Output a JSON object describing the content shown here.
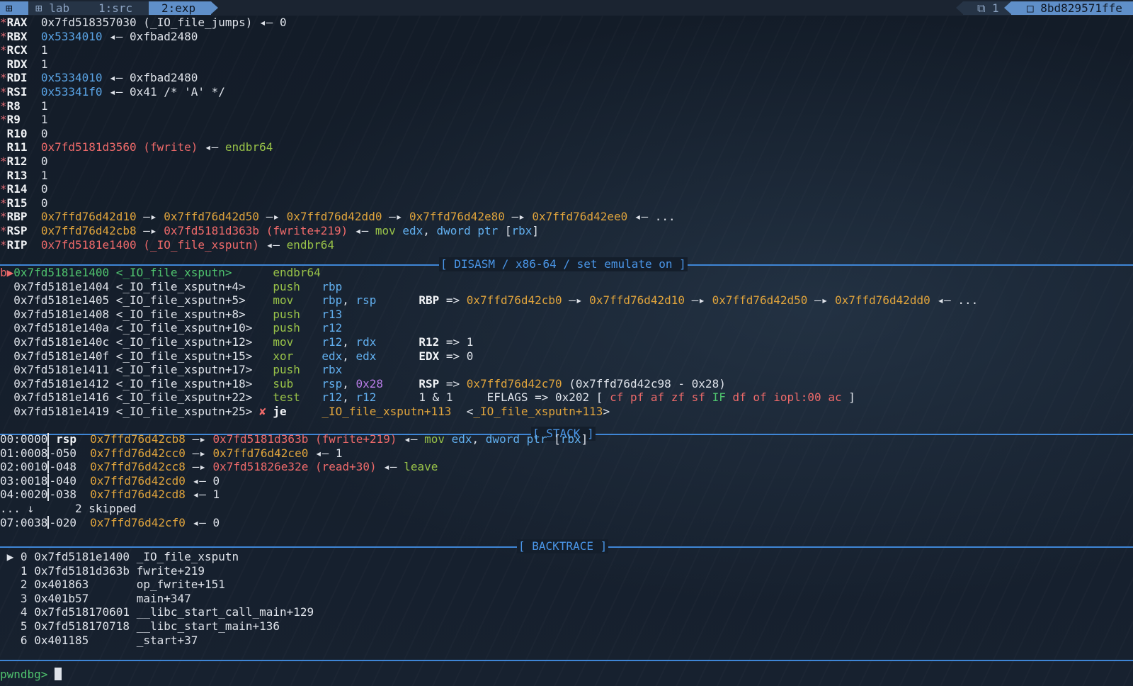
{
  "tmux": {
    "icon": "⊞",
    "session": "⊞ lab",
    "win1": "1:src",
    "win2": "2:exp",
    "right_count": "⧉ 1",
    "right_host": "□ 8bd829571ffe"
  },
  "registers": [
    {
      "star": "*",
      "name": "RAX",
      "parts": [
        [
          "w",
          "0x7fd518357030 (_IO_file_jumps) ◂— 0"
        ]
      ]
    },
    {
      "star": "*",
      "name": "RBX",
      "parts": [
        [
          "b",
          "0x5334010"
        ],
        [
          "w",
          " ◂— 0xfbad2480"
        ]
      ]
    },
    {
      "star": "*",
      "name": "RCX",
      "parts": [
        [
          "w",
          "1"
        ]
      ]
    },
    {
      "star": " ",
      "name": "RDX",
      "parts": [
        [
          "w",
          "1"
        ]
      ]
    },
    {
      "star": "*",
      "name": "RDI",
      "parts": [
        [
          "b",
          "0x5334010"
        ],
        [
          "w",
          " ◂— 0xfbad2480"
        ]
      ]
    },
    {
      "star": "*",
      "name": "RSI",
      "parts": [
        [
          "b",
          "0x53341f0"
        ],
        [
          "w",
          " ◂— 0x41 /* 'A' */"
        ]
      ]
    },
    {
      "star": "*",
      "name": "R8 ",
      "parts": [
        [
          "w",
          "1"
        ]
      ]
    },
    {
      "star": "*",
      "name": "R9 ",
      "parts": [
        [
          "w",
          "1"
        ]
      ]
    },
    {
      "star": " ",
      "name": "R10",
      "parts": [
        [
          "w",
          "0"
        ]
      ]
    },
    {
      "star": " ",
      "name": "R11",
      "parts": [
        [
          "r",
          "0x7fd5181d3560 (fwrite)"
        ],
        [
          "w",
          " ◂— "
        ],
        [
          "g",
          "endbr64"
        ]
      ]
    },
    {
      "star": "*",
      "name": "R12",
      "parts": [
        [
          "w",
          "0"
        ]
      ]
    },
    {
      "star": " ",
      "name": "R13",
      "parts": [
        [
          "w",
          "1"
        ]
      ]
    },
    {
      "star": "*",
      "name": "R14",
      "parts": [
        [
          "w",
          "0"
        ]
      ]
    },
    {
      "star": "*",
      "name": "R15",
      "parts": [
        [
          "w",
          "0"
        ]
      ]
    },
    {
      "star": "*",
      "name": "RBP",
      "parts": [
        [
          "o",
          "0x7ffd76d42d10"
        ],
        [
          "w",
          " —▸ "
        ],
        [
          "o",
          "0x7ffd76d42d50"
        ],
        [
          "w",
          " —▸ "
        ],
        [
          "o",
          "0x7ffd76d42dd0"
        ],
        [
          "w",
          " —▸ "
        ],
        [
          "o",
          "0x7ffd76d42e80"
        ],
        [
          "w",
          " —▸ "
        ],
        [
          "o",
          "0x7ffd76d42ee0"
        ],
        [
          "w",
          " ◂— ..."
        ]
      ]
    },
    {
      "star": "*",
      "name": "RSP",
      "parts": [
        [
          "o",
          "0x7ffd76d42cb8"
        ],
        [
          "w",
          " —▸ "
        ],
        [
          "r",
          "0x7fd5181d363b (fwrite+219)"
        ],
        [
          "w",
          " ◂— "
        ],
        [
          "g",
          "mov "
        ],
        [
          "c",
          "edx"
        ],
        [
          "w",
          ", "
        ],
        [
          "c",
          "dword ptr "
        ],
        [
          "w",
          "["
        ],
        [
          "c",
          "rbx"
        ],
        [
          "w",
          "]"
        ]
      ]
    },
    {
      "star": "*",
      "name": "RIP",
      "parts": [
        [
          "r",
          "0x7fd5181e1400 (_IO_file_xsputn)"
        ],
        [
          "w",
          " ◂— "
        ],
        [
          "g",
          "endbr64"
        ]
      ]
    }
  ],
  "sections": {
    "disasm": "[ DISASM / x86-64 / set emulate on ]",
    "stack": "[ STACK ]",
    "backtrace": "[ BACKTRACE ]"
  },
  "disasm": [
    {
      "marker": "b▶",
      "addr": "0x7fd5181e1400",
      "sym": "<_IO_file_xsputn>   ",
      "taken": " ",
      "mn": "endbr64",
      "ops": [],
      "emu": [],
      "current": true
    },
    {
      "marker": "  ",
      "addr": "0x7fd5181e1404",
      "sym": "<_IO_file_xsputn+4> ",
      "taken": " ",
      "mn": "push",
      "ops": [
        [
          "c",
          "rbp"
        ]
      ],
      "emu": []
    },
    {
      "marker": "  ",
      "addr": "0x7fd5181e1405",
      "sym": "<_IO_file_xsputn+5> ",
      "taken": " ",
      "mn": "mov",
      "ops": [
        [
          "c",
          "rbp"
        ],
        [
          "w",
          ", "
        ],
        [
          "c",
          "rsp"
        ]
      ],
      "emu": [
        [
          "bold",
          "RBP"
        ],
        [
          "w",
          " => "
        ],
        [
          "o",
          "0x7ffd76d42cb0"
        ],
        [
          "w",
          " —▸ "
        ],
        [
          "o",
          "0x7ffd76d42d10"
        ],
        [
          "w",
          " —▸ "
        ],
        [
          "o",
          "0x7ffd76d42d50"
        ],
        [
          "w",
          " —▸ "
        ],
        [
          "o",
          "0x7ffd76d42dd0"
        ],
        [
          "w",
          " ◂— ..."
        ]
      ]
    },
    {
      "marker": "  ",
      "addr": "0x7fd5181e1408",
      "sym": "<_IO_file_xsputn+8> ",
      "taken": " ",
      "mn": "push",
      "ops": [
        [
          "c",
          "r13"
        ]
      ],
      "emu": []
    },
    {
      "marker": "  ",
      "addr": "0x7fd5181e140a",
      "sym": "<_IO_file_xsputn+10>",
      "taken": " ",
      "mn": "push",
      "ops": [
        [
          "c",
          "r12"
        ]
      ],
      "emu": []
    },
    {
      "marker": "  ",
      "addr": "0x7fd5181e140c",
      "sym": "<_IO_file_xsputn+12>",
      "taken": " ",
      "mn": "mov",
      "ops": [
        [
          "c",
          "r12"
        ],
        [
          "w",
          ", "
        ],
        [
          "c",
          "rdx"
        ]
      ],
      "emu": [
        [
          "bold",
          "R12"
        ],
        [
          "w",
          " => 1"
        ]
      ]
    },
    {
      "marker": "  ",
      "addr": "0x7fd5181e140f",
      "sym": "<_IO_file_xsputn+15>",
      "taken": " ",
      "mn": "xor",
      "ops": [
        [
          "c",
          "edx"
        ],
        [
          "w",
          ", "
        ],
        [
          "c",
          "edx"
        ]
      ],
      "emu": [
        [
          "bold",
          "EDX"
        ],
        [
          "w",
          " => 0"
        ]
      ]
    },
    {
      "marker": "  ",
      "addr": "0x7fd5181e1411",
      "sym": "<_IO_file_xsputn+17>",
      "taken": " ",
      "mn": "push",
      "ops": [
        [
          "c",
          "rbx"
        ]
      ],
      "emu": []
    },
    {
      "marker": "  ",
      "addr": "0x7fd5181e1412",
      "sym": "<_IO_file_xsputn+18>",
      "taken": " ",
      "mn": "sub",
      "ops": [
        [
          "c",
          "rsp"
        ],
        [
          "w",
          ", "
        ],
        [
          "p",
          "0x28"
        ]
      ],
      "emu": [
        [
          "bold",
          "RSP"
        ],
        [
          "w",
          " => "
        ],
        [
          "o",
          "0x7ffd76d42c70"
        ],
        [
          "w",
          " (0x7ffd76d42c98 - 0x28)"
        ]
      ]
    },
    {
      "marker": "  ",
      "addr": "0x7fd5181e1416",
      "sym": "<_IO_file_xsputn+22>",
      "taken": " ",
      "mn": "test",
      "ops": [
        [
          "c",
          "r12"
        ],
        [
          "w",
          ", "
        ],
        [
          "c",
          "r12"
        ]
      ],
      "emu": [
        [
          "w",
          "1 & 1     EFLAGS => 0x202 [ "
        ],
        [
          "r",
          "cf pf af zf sf "
        ],
        [
          "gr",
          "IF"
        ],
        [
          "r",
          " df of iopl:00 ac"
        ],
        [
          "w",
          " ]"
        ]
      ]
    },
    {
      "marker": "  ",
      "addr": "0x7fd5181e1419",
      "sym": "<_IO_file_xsputn+25>",
      "taken": "✘",
      "mn": "je",
      "ops": [
        [
          "o",
          "_IO_file_xsputn+113"
        ]
      ],
      "emu": [
        [
          "w",
          "       <"
        ],
        [
          "o",
          "_IO_file_xsputn+113"
        ],
        [
          "w",
          ">"
        ]
      ],
      "bold_mn": true
    }
  ],
  "stack": [
    {
      "idx": "00:0000",
      "off": " rsp",
      "parts": [
        [
          "o",
          "0x7ffd76d42cb8"
        ],
        [
          "w",
          " —▸ "
        ],
        [
          "r",
          "0x7fd5181d363b (fwrite+219)"
        ],
        [
          "w",
          " ◂— "
        ],
        [
          "g",
          "mov "
        ],
        [
          "c",
          "edx"
        ],
        [
          "w",
          ", "
        ],
        [
          "c",
          "dword ptr "
        ],
        [
          "w",
          "["
        ],
        [
          "c",
          "rbx"
        ],
        [
          "w",
          "]"
        ]
      ]
    },
    {
      "idx": "01:0008",
      "off": "-050",
      "parts": [
        [
          "o",
          "0x7ffd76d42cc0"
        ],
        [
          "w",
          " —▸ "
        ],
        [
          "o",
          "0x7ffd76d42ce0"
        ],
        [
          "w",
          " ◂— 1"
        ]
      ]
    },
    {
      "idx": "02:0010",
      "off": "-048",
      "parts": [
        [
          "o",
          "0x7ffd76d42cc8"
        ],
        [
          "w",
          " —▸ "
        ],
        [
          "r",
          "0x7fd51826e32e (read+30)"
        ],
        [
          "w",
          " ◂— "
        ],
        [
          "g",
          "leave"
        ]
      ]
    },
    {
      "idx": "03:0018",
      "off": "-040",
      "parts": [
        [
          "o",
          "0x7ffd76d42cd0"
        ],
        [
          "w",
          " ◂— 0"
        ]
      ]
    },
    {
      "idx": "04:0020",
      "off": "-038",
      "parts": [
        [
          "o",
          "0x7ffd76d42cd8"
        ],
        [
          "w",
          " ◂— 1"
        ]
      ]
    },
    {
      "idx": "... ↓",
      "off": "",
      "parts": [
        [
          "w",
          "2 skipped"
        ]
      ],
      "skip": true
    },
    {
      "idx": "07:0038",
      "off": "-020",
      "parts": [
        [
          "o",
          "0x7ffd76d42cf0"
        ],
        [
          "w",
          " ◂— 0"
        ]
      ]
    }
  ],
  "backtrace": [
    {
      "mark": " ▶",
      "n": "0",
      "addr": "0x7fd5181e1400",
      "sym": "_IO_file_xsputn"
    },
    {
      "mark": "  ",
      "n": "1",
      "addr": "0x7fd5181d363b",
      "sym": "fwrite+219"
    },
    {
      "mark": "  ",
      "n": "2",
      "addr": "0x401863      ",
      "sym": "op_fwrite+151"
    },
    {
      "mark": "  ",
      "n": "3",
      "addr": "0x401b57      ",
      "sym": "main+347"
    },
    {
      "mark": "  ",
      "n": "4",
      "addr": "0x7fd518170601",
      "sym": "__libc_start_call_main+129"
    },
    {
      "mark": "  ",
      "n": "5",
      "addr": "0x7fd518170718",
      "sym": "__libc_start_main+136"
    },
    {
      "mark": "  ",
      "n": "6",
      "addr": "0x401185      ",
      "sym": "_start+37"
    }
  ],
  "prompt": "pwndbg> "
}
